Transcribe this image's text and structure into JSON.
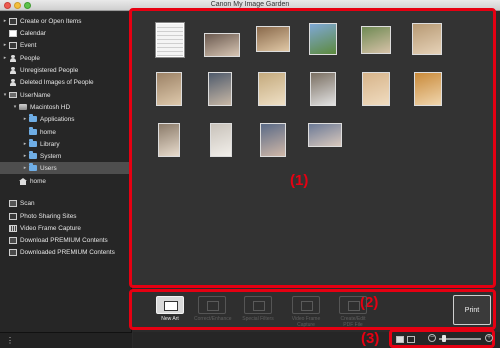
{
  "window": {
    "title": "Canon My Image Garden"
  },
  "sidebar": {
    "items": [
      {
        "label": "Create or Open Items",
        "icon": "create-icon"
      },
      {
        "label": "Calendar",
        "icon": "calendar-icon"
      },
      {
        "label": "Event",
        "icon": "event-icon"
      },
      {
        "label": "People",
        "icon": "people-icon"
      },
      {
        "label": "Unregistered People",
        "icon": "person-icon"
      },
      {
        "label": "Deleted Images of People",
        "icon": "person-icon"
      },
      {
        "label": "UserName",
        "icon": "computer-icon"
      },
      {
        "label": "Macintosh HD",
        "icon": "disk-icon"
      },
      {
        "label": "Applications",
        "icon": "folder-icon"
      },
      {
        "label": "home",
        "icon": "folder-icon"
      },
      {
        "label": "Library",
        "icon": "folder-icon"
      },
      {
        "label": "System",
        "icon": "folder-icon"
      },
      {
        "label": "Users",
        "icon": "folder-icon",
        "selected": true
      },
      {
        "label": "home",
        "icon": "home-icon"
      },
      {
        "label": "Scan",
        "icon": "scan-icon"
      },
      {
        "label": "Photo Sharing Sites",
        "icon": "photo-sites-icon"
      },
      {
        "label": "Video Frame Capture",
        "icon": "film-icon"
      },
      {
        "label": "Download PREMIUM Contents",
        "icon": "download-icon"
      },
      {
        "label": "Downloaded PREMIUM Contents",
        "icon": "download-icon"
      }
    ]
  },
  "main": {
    "callouts": {
      "thumbnails": "(1)",
      "actions": "(2)",
      "status": "(3)"
    },
    "thumbnails": [
      {
        "kind": "document",
        "colors": [
          "#f4f4f4",
          "#cfcfcf"
        ]
      },
      {
        "kind": "photo",
        "colors": [
          "#6b5a50",
          "#d8c6b4"
        ]
      },
      {
        "kind": "photo",
        "colors": [
          "#8a6a4c",
          "#e0c8a6"
        ]
      },
      {
        "kind": "photo",
        "colors": [
          "#7fa8d6",
          "#5d8a3d"
        ]
      },
      {
        "kind": "photo",
        "colors": [
          "#6f8a54",
          "#d7c2a8"
        ]
      },
      {
        "kind": "photo",
        "colors": [
          "#b79a74",
          "#e6d2b8"
        ]
      },
      {
        "kind": "photo",
        "colors": [
          "#9c8266",
          "#dec9ac"
        ]
      },
      {
        "kind": "photo",
        "colors": [
          "#4f5b6c",
          "#c8b8a6"
        ]
      },
      {
        "kind": "photo",
        "colors": [
          "#c4aa7d",
          "#efe0c6"
        ]
      },
      {
        "kind": "photo",
        "colors": [
          "#7a6f62",
          "#e2e2e2"
        ]
      },
      {
        "kind": "photo",
        "colors": [
          "#d7b48a",
          "#f0dcc0"
        ]
      },
      {
        "kind": "photo",
        "colors": [
          "#c98a3a",
          "#f0d6ae"
        ]
      },
      {
        "kind": "photo",
        "colors": [
          "#8b7b6a",
          "#e8dccd"
        ]
      },
      {
        "kind": "photo",
        "colors": [
          "#c8c2ba",
          "#f2efea"
        ]
      },
      {
        "kind": "photo",
        "colors": [
          "#5a6a86",
          "#d0b8a8"
        ]
      },
      {
        "kind": "photo",
        "colors": [
          "#6c7a96",
          "#d9c9bd"
        ]
      }
    ],
    "actions": [
      {
        "label": "New Art",
        "enabled": true,
        "icon": "new-art-icon"
      },
      {
        "label": "Correct/Enhance",
        "enabled": false,
        "icon": "correct-icon"
      },
      {
        "label": "Special Filters",
        "enabled": false,
        "icon": "filters-icon"
      },
      {
        "label": "Video Frame Capture",
        "enabled": false,
        "icon": "film-icon"
      },
      {
        "label": "Create/Edit PDF File",
        "enabled": false,
        "icon": "pdf-icon"
      }
    ],
    "print_label": "Print"
  },
  "colors": {
    "accent": "#e60012",
    "background": "#2b2b2b",
    "sidebar": "#262626",
    "selection": "#4e4e4e"
  }
}
